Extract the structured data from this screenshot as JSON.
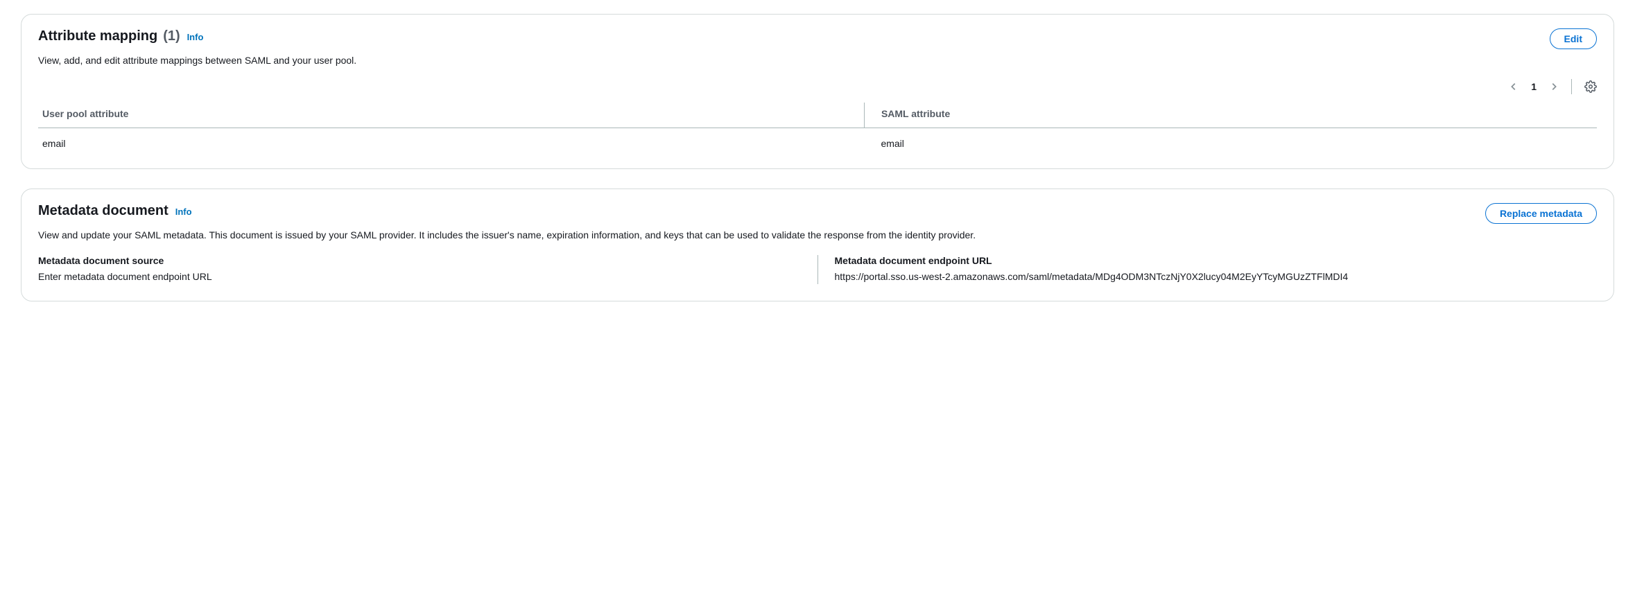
{
  "attributeMapping": {
    "title": "Attribute mapping",
    "count": "(1)",
    "info": "Info",
    "editLabel": "Edit",
    "description": "View, add, and edit attribute mappings between SAML and your user pool.",
    "page": "1",
    "columns": {
      "userPool": "User pool attribute",
      "saml": "SAML attribute"
    },
    "rows": [
      {
        "userPool": "email",
        "saml": "email"
      }
    ]
  },
  "metadataDocument": {
    "title": "Metadata document",
    "info": "Info",
    "replaceLabel": "Replace metadata",
    "description": "View and update your SAML metadata. This document is issued by your SAML provider. It includes the issuer's name, expiration information, and keys that can be used to validate the response from the identity provider.",
    "sourceLabel": "Metadata document source",
    "sourceValue": "Enter metadata document endpoint URL",
    "endpointLabel": "Metadata document endpoint URL",
    "endpointValue": "https://portal.sso.us-west-2.amazonaws.com/saml/metadata/MDg4ODM3NTczNjY0X2lucy04M2EyYTcyMGUzZTFlMDI4"
  }
}
